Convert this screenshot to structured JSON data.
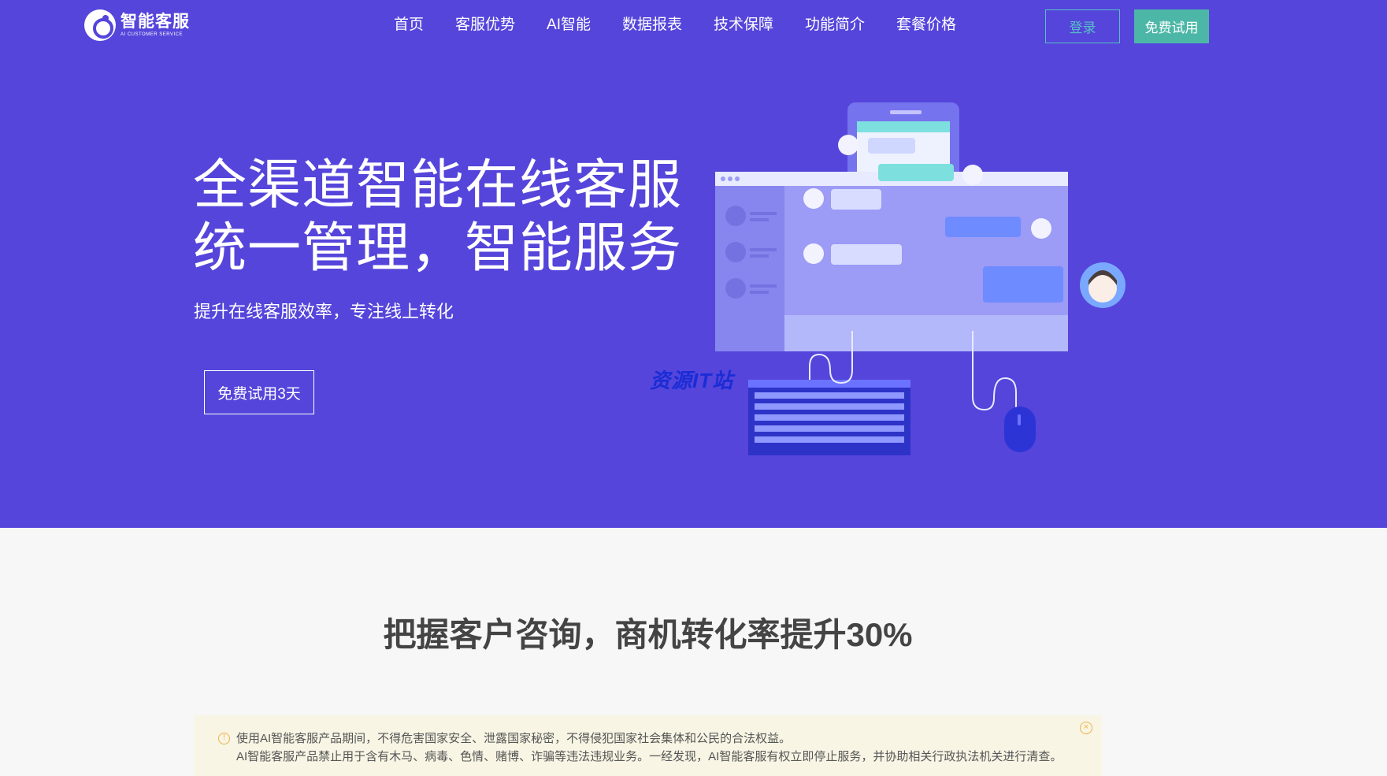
{
  "header": {
    "logo_cn": "智能客服",
    "logo_en": "AI CUSTOMER SERVICE",
    "nav": [
      "首页",
      "客服优势",
      "AI智能",
      "数据报表",
      "技术保障",
      "功能简介",
      "套餐价格"
    ],
    "login_label": "登录",
    "trial_label": "免费试用"
  },
  "hero": {
    "title_line1": "全渠道智能在线客服",
    "title_line2": "统一管理，智能服务",
    "subtitle": "提升在线客服效率，专注线上转化",
    "cta_label": "免费试用3天",
    "watermark": "资源IT站"
  },
  "section": {
    "title": "把握客户咨询，商机转化率提升30%"
  },
  "notice": {
    "icon": "info-icon",
    "line1": "使用AI智能客服产品期间，不得危害国家安全、泄露国家秘密，不得侵犯国家社会集体和公民的合法权益。",
    "line2": "AI智能客服产品禁止用于含有木马、病毒、色情、赌博、诈骗等违法违规业务。一经发现，AI智能客服有权立即停止服务，并协助相关行政执法机关进行清查。",
    "close_icon": "close-icon"
  },
  "colors": {
    "hero_bg": "#5545db",
    "accent_teal": "#4db7a7",
    "notice_bg": "#f8f5e4"
  }
}
